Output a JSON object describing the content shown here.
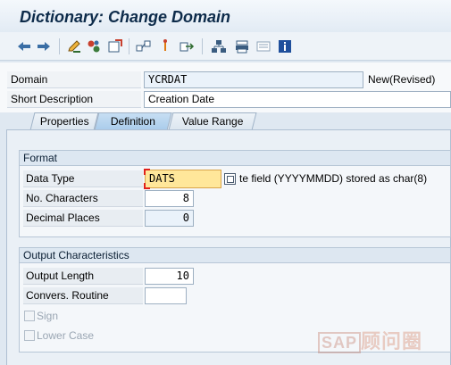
{
  "window": {
    "title": "Dictionary: Change Domain"
  },
  "toolbar": {
    "icons": [
      "back-arrow-icon",
      "forward-arrow-icon",
      "edit-pencil-icon",
      "other-object-icon",
      "activate-icon",
      "where-used-icon",
      "object-list-icon",
      "navigate-icon",
      "hierarchy-icon",
      "print-icon",
      "display-icon",
      "info-icon"
    ]
  },
  "header": {
    "domain_label": "Domain",
    "domain_value": "YCRDAT",
    "domain_status": "New(Revised)",
    "shortdesc_label": "Short Description",
    "shortdesc_value": "Creation Date"
  },
  "tabs": [
    {
      "label": "Properties",
      "active": false
    },
    {
      "label": "Definition",
      "active": true
    },
    {
      "label": "Value Range",
      "active": false
    }
  ],
  "format": {
    "group_title": "Format",
    "data_type_label": "Data Type",
    "data_type_value": "DATS",
    "data_type_desc": "te field (YYYYMMDD) stored as char(8)",
    "no_chars_label": "No. Characters",
    "no_chars_value": "8",
    "decimals_label": "Decimal Places",
    "decimals_value": "0"
  },
  "output": {
    "group_title": "Output Characteristics",
    "output_length_label": "Output Length",
    "output_length_value": "10",
    "conv_routine_label": "Convers. Routine",
    "conv_routine_value": "",
    "sign_label": "Sign",
    "sign_checked": false,
    "lowercase_label": "Lower Case",
    "lowercase_checked": false
  },
  "watermark": {
    "brand": "SAP",
    "text": "顾问圈"
  },
  "colors": {
    "accent": "#a9cbeb",
    "required_field": "#ffe79a",
    "title": "#0d2b4a"
  }
}
